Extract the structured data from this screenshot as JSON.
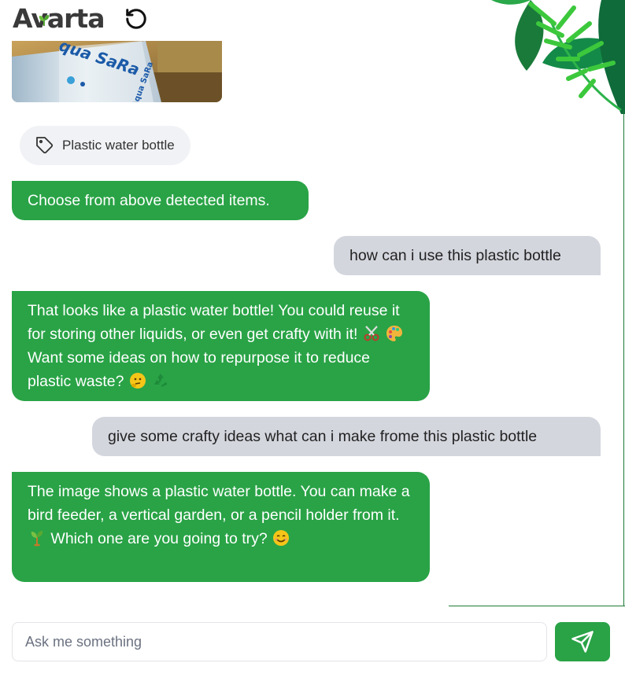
{
  "header": {
    "logo_text": "Avarta",
    "reset_icon": "rotate-ccw-icon"
  },
  "upload": {
    "label_line1": "qua SaRa",
    "label_line2": "Aqua SaRa"
  },
  "detected_items": [
    {
      "label": "Plastic water bottle",
      "icon": "tag-icon"
    }
  ],
  "messages": [
    {
      "role": "bot",
      "text": "Choose from above detected items."
    },
    {
      "role": "user",
      "text": "how can i use this plastic bottle"
    },
    {
      "role": "bot",
      "text_parts": [
        "That looks like a plastic water bottle! You could reuse it for storing other liquids, or even get crafty with it!",
        "Want some ideas on how to repurpose it to reduce plastic waste?"
      ],
      "emojis": [
        "scissors",
        "palette",
        "thinking-face",
        "recycle"
      ]
    },
    {
      "role": "user",
      "text": "give some crafty ideas what can i make frome this plastic bottle"
    },
    {
      "role": "bot",
      "text_parts": [
        "The image shows a plastic water bottle. You can make a bird feeder, a vertical garden, or a pencil holder from it.",
        "Which one are you going to try?"
      ],
      "emojis": [
        "seedling",
        "smiling-face"
      ]
    }
  ],
  "input": {
    "placeholder": "Ask me something",
    "value": ""
  },
  "send_icon": "send-icon",
  "colors": {
    "brand_green": "#29a346",
    "user_bubble": "#d4d6de",
    "chip_bg": "#f1f2f5"
  }
}
